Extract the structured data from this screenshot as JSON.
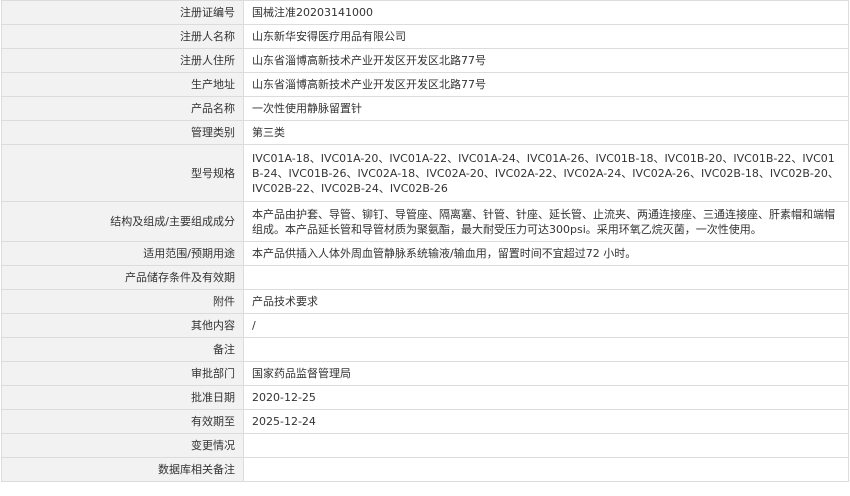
{
  "rows": [
    {
      "label": "注册证编号",
      "value": "国械注准20203141000"
    },
    {
      "label": "注册人名称",
      "value": "山东新华安得医疗用品有限公司"
    },
    {
      "label": "注册人住所",
      "value": "山东省淄博高新技术产业开发区开发区北路77号"
    },
    {
      "label": "生产地址",
      "value": "山东省淄博高新技术产业开发区开发区北路77号"
    },
    {
      "label": "产品名称",
      "value": "一次性使用静脉留置针"
    },
    {
      "label": "管理类别",
      "value": "第三类"
    },
    {
      "label": "型号规格",
      "value": "IVC01A-18、IVC01A-20、IVC01A-22、IVC01A-24、IVC01A-26、IVC01B-18、IVC01B-20、IVC01B-22、IVC01B-24、IVC01B-26、IVC02A-18、IVC02A-20、IVC02A-22、IVC02A-24、IVC02A-26、IVC02B-18、IVC02B-20、IVC02B-22、IVC02B-24、IVC02B-26"
    },
    {
      "label": "结构及组成/主要组成成分",
      "value": "本产品由护套、导管、铆钉、导管座、隔离塞、针管、针座、延长管、止流夹、两通连接座、三通连接座、肝素帽和端帽组成。本产品延长管和导管材质为聚氨酯，最大耐受压力可达300psi。采用环氧乙烷灭菌，一次性使用。"
    },
    {
      "label": "适用范围/预期用途",
      "value": "本产品供插入人体外周血管静脉系统输液/输血用，留置时间不宜超过72 小时。"
    },
    {
      "label": "产品储存条件及有效期",
      "value": ""
    },
    {
      "label": "附件",
      "value": "产品技术要求"
    },
    {
      "label": "其他内容",
      "value": "/"
    },
    {
      "label": "备注",
      "value": ""
    },
    {
      "label": "审批部门",
      "value": "国家药品监督管理局"
    },
    {
      "label": "批准日期",
      "value": "2020-12-25"
    },
    {
      "label": "有效期至",
      "value": "2025-12-24"
    },
    {
      "label": "变更情况",
      "value": ""
    },
    {
      "label": "数据库相关备注",
      "value": ""
    }
  ]
}
